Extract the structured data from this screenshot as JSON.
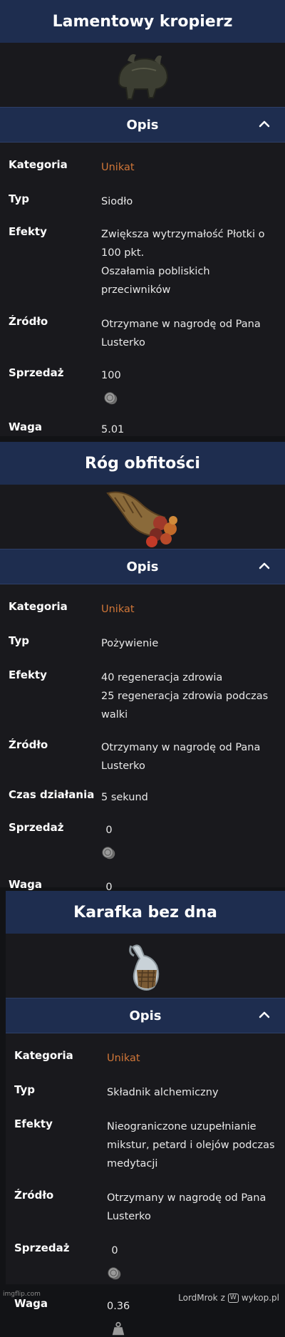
{
  "cards": [
    {
      "title": "Lamentowy kropierz",
      "section": "Opis",
      "icon": "saddle-icon",
      "kategoria_label": "Kategoria",
      "kategoria": "Unikat",
      "typ_label": "Typ",
      "typ": "Siodło",
      "efekty_label": "Efekty",
      "efekty": [
        "Zwiększa wytrzymałość Płotki o",
        "100 pkt.",
        "Oszałamia pobliskich",
        "przeciwników"
      ],
      "zrodlo_label": "Źródło",
      "zrodlo": [
        "Otrzymane w nagrodę od Pana",
        "Lusterko"
      ],
      "sprzedaz_label": "Sprzedaż",
      "sprzedaz": "100",
      "waga_label": "Waga",
      "waga": "5.01"
    },
    {
      "title": "Róg obfitości",
      "section": "Opis",
      "icon": "cornucopia-icon",
      "kategoria_label": "Kategoria",
      "kategoria": "Unikat",
      "typ_label": "Typ",
      "typ": "Pożywienie",
      "efekty_label": "Efekty",
      "efekty": [
        "40 regeneracja zdrowia",
        "25 regeneracja zdrowia podczas",
        "walki"
      ],
      "zrodlo_label": "Źródło",
      "zrodlo": [
        "Otrzymany w nagrodę od Pana",
        "Lusterko"
      ],
      "czas_label": "Czas działania",
      "czas": "5 sekund",
      "sprzedaz_label": "Sprzedaż",
      "sprzedaz": "0",
      "waga_label": "Waga",
      "waga": "0"
    },
    {
      "title": "Karafka bez dna",
      "section": "Opis",
      "icon": "carafe-icon",
      "kategoria_label": "Kategoria",
      "kategoria": "Unikat",
      "typ_label": "Typ",
      "typ": "Składnik alchemiczny",
      "efekty_label": "Efekty",
      "efekty": [
        "Nieograniczone uzupełnianie",
        "mikstur, petard i olejów podczas",
        "medytacji"
      ],
      "zrodlo_label": "Źródło",
      "zrodlo": [
        "Otrzymany w nagrodę od Pana",
        "Lusterko"
      ],
      "sprzedaz_label": "Sprzedaż",
      "sprzedaz": "0",
      "waga_label": "Waga",
      "waga": "0.36"
    }
  ],
  "footer": {
    "imgflip": "imgflip.com",
    "author": "LordMrok",
    "z": "z",
    "site": "wykop.pl"
  }
}
